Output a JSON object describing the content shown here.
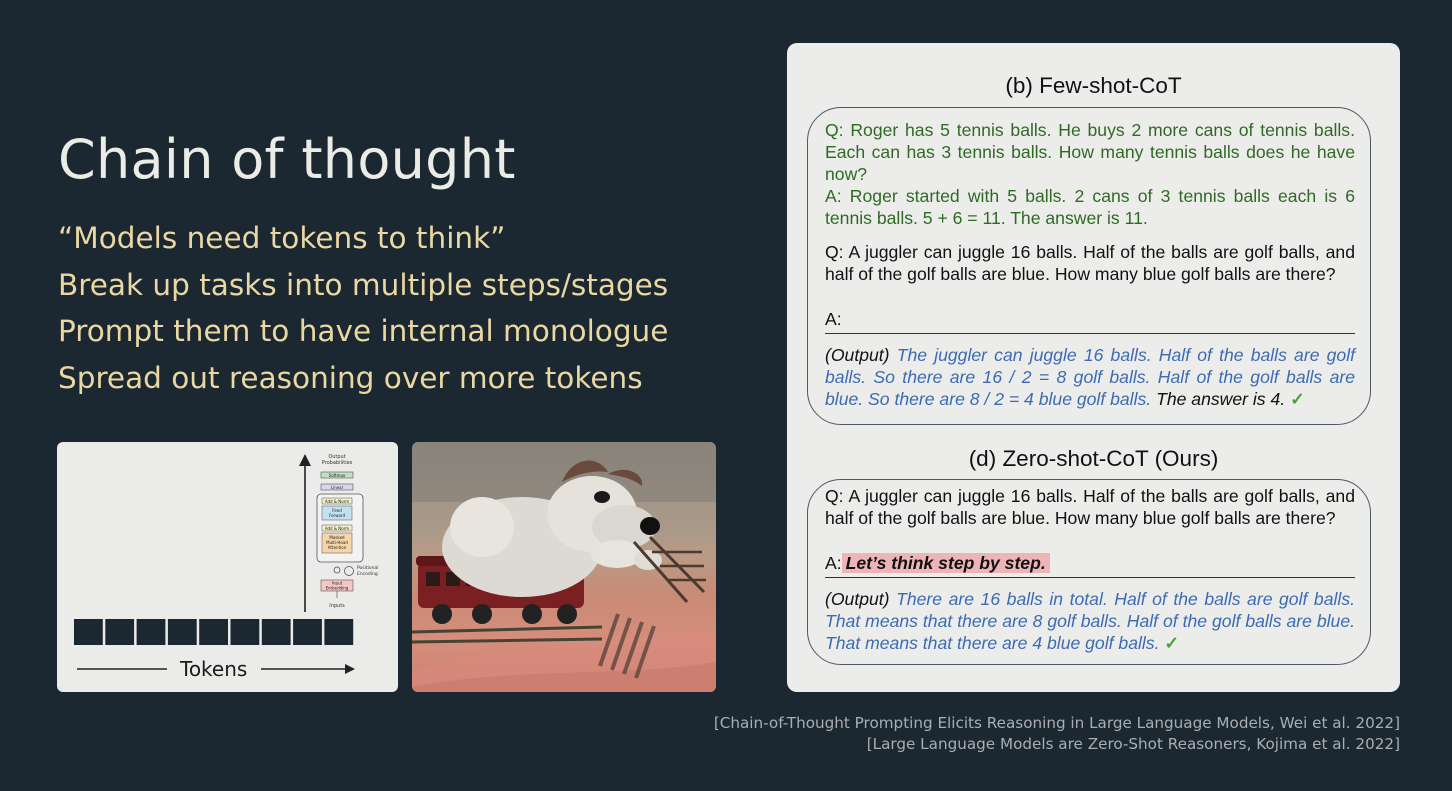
{
  "slide": {
    "title": "Chain of thought",
    "bullets": [
      "“Models need tokens to think”",
      "Break up tasks into multiple steps/stages",
      "Prompt them to have internal monologue",
      "Spread out reasoning over more tokens"
    ]
  },
  "transformer": {
    "output_label_1": "Output",
    "output_label_2": "Probabilities",
    "softmax": "Softmax",
    "linear": "Linear",
    "add_norm": "Add & Norm",
    "feed_forward_1": "Feed",
    "feed_forward_2": "Forward",
    "masked_1": "Masked",
    "masked_2": "Multi-Head",
    "masked_3": "Attention",
    "positional_1": "Positional",
    "positional_2": "Encoding",
    "input_embedding_1": "Input",
    "input_embedding_2": "Embedding",
    "inputs": "Inputs",
    "tokens_label": "Tokens",
    "token_count": 9
  },
  "figure": {
    "few_shot_title": "(b) Few-shot-CoT",
    "few_q1": "Q: Roger has 5 tennis balls. He buys 2 more cans of tennis balls. Each can has 3 tennis balls. How many tennis balls does he have now?",
    "few_a1": "A: Roger started with 5 balls. 2 cans of 3 tennis balls each is 6 tennis balls. 5 + 6 = 11. The answer is 11.",
    "few_q2": "Q: A juggler can juggle 16 balls. Half of the balls are golf balls, and half of the golf balls are blue. How many blue golf balls are there?",
    "few_a2": "A:",
    "few_output_label": "(Output)",
    "few_output_text": "The juggler can juggle 16 balls. Half of the balls are golf balls. So there are 16 / 2 = 8 golf balls. Half of the golf balls are blue. So there are 8 / 2 = 4 blue golf balls.",
    "few_output_answer": "The answer is 4.",
    "check": "✓",
    "zero_shot_title": "(d) Zero-shot-CoT (Ours)",
    "zero_q": "Q: A juggler can juggle 16 balls. Half of the balls are golf balls, and half of the golf balls are blue. How many blue golf balls are there?",
    "zero_a_prefix": "A:",
    "zero_a_highlight": "Let’s think step by step.",
    "zero_output_label": "(Output)",
    "zero_output_text": "There are 16 balls in total. Half of the balls are golf balls. That means that there are 8 golf balls. Half of the golf balls are blue. That means that there are 4 blue golf balls."
  },
  "citations": [
    "[Chain-of-Thought Prompting Elicits Reasoning in Large Language Models, Wei et al. 2022]",
    "[Large Language Models are Zero-Shot Reasoners, Kojima et al. 2022]"
  ],
  "colors": {
    "background": "#1b2731",
    "title": "#ecece6",
    "bullet": "#ead8a2",
    "example_green": "#2f6a24",
    "output_blue": "#3c6bb3",
    "highlight": "#eeb5b8",
    "check": "#4aa33a"
  }
}
